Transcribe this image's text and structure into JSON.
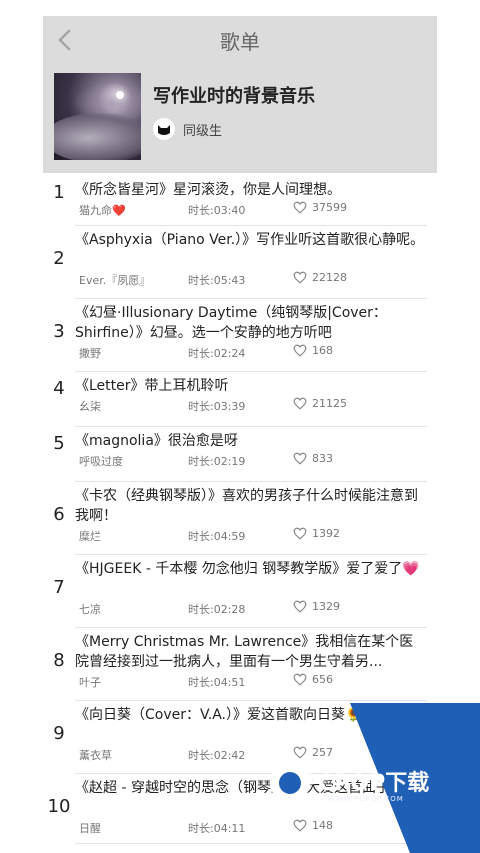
{
  "header": {
    "title": "歌单",
    "playlist_name": "写作业时的背景音乐",
    "creator": "同级生"
  },
  "songs": [
    {
      "index": "1",
      "title": "《所念皆星河》星河滚烫，你是人间理想。",
      "artist": "猫九命",
      "artist_heart": "❤️",
      "duration": "时长:03:40",
      "likes": "37599"
    },
    {
      "index": "2",
      "title": "《Asphyxia（Piano Ver.）》写作业听这首歌很心静呢。",
      "artist": "Ever.『夙愿』",
      "duration": "时长:05:43",
      "likes": "22128"
    },
    {
      "index": "3",
      "title": "《幻昼·Illusionary Daytime（纯钢琴版|Cover：Shirfine）》幻昼。选一个安静的地方听吧",
      "artist": "撒野",
      "duration": "时长:02:24",
      "likes": "168"
    },
    {
      "index": "4",
      "title": "《Letter》带上耳机聆听",
      "artist": "幺柒",
      "duration": "时长:03:39",
      "likes": "21125"
    },
    {
      "index": "5",
      "title": "《magnolia》很治愈是呀",
      "artist": "呼吸过度",
      "duration": "时长:02:19",
      "likes": "833"
    },
    {
      "index": "6",
      "title": "《卡农（经典钢琴版）》喜欢的男孩子什么时候能注意到我啊！",
      "artist": "糜烂",
      "duration": "时长:04:59",
      "likes": "1392"
    },
    {
      "index": "7",
      "title": "《HJGEEK - 千本樱 勿念他归 钢琴教学版》爱了爱了💗",
      "artist": "七凉",
      "duration": "时长:02:28",
      "likes": "1329"
    },
    {
      "index": "8",
      "title": "《Merry Christmas Mr. Lawrence》我相信在某个医院曾经接到过一批病人，里面有一个男生守着另...",
      "artist": "叶子",
      "duration": "时长:04:51",
      "likes": "656"
    },
    {
      "index": "9",
      "title": "《向日葵（Cover：V.A.）》爱这首歌向日葵🌻",
      "artist": "薰衣草",
      "duration": "时长:02:42",
      "likes": "257"
    },
    {
      "index": "10",
      "title": "《赵超 - 穿越时空的思念（钢琴版）》大爱这首曲子",
      "artist": "日醒",
      "duration": "时长:04:11",
      "likes": "148"
    }
  ],
  "watermark": {
    "text": "PCPOP下载",
    "sub": "WWW.PCPOP.COM"
  },
  "colors": {
    "header_bg": "#dcdcdc",
    "accent": "#1f5fb5"
  },
  "icons": {
    "back": "chevron-left-icon",
    "like": "heart-outline-icon"
  }
}
